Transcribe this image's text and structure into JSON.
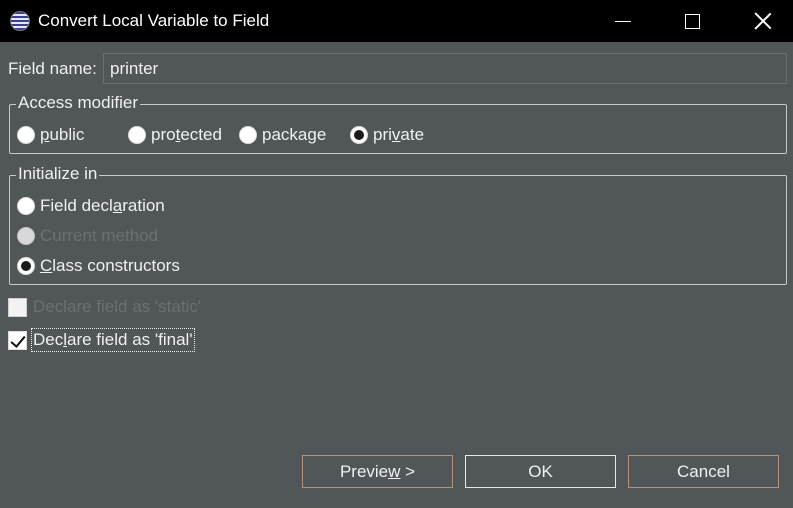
{
  "window": {
    "title": "Convert Local Variable to Field",
    "icon": "eclipse-icon"
  },
  "field_name": {
    "label": "Field name:",
    "value": "printer"
  },
  "access_modifier": {
    "title": "Access modifier",
    "options": [
      {
        "pre": "",
        "mn": "p",
        "post": "ublic",
        "checked": false
      },
      {
        "pre": "pro",
        "mn": "t",
        "post": "ected",
        "checked": false
      },
      {
        "pre": "packa",
        "mn": "g",
        "post": "e",
        "checked": false
      },
      {
        "pre": "pri",
        "mn": "v",
        "post": "ate",
        "checked": true
      }
    ]
  },
  "initialize_in": {
    "title": "Initialize in",
    "options": [
      {
        "pre": "Field decl",
        "mn": "a",
        "post": "ration",
        "checked": false,
        "enabled": true
      },
      {
        "pre": "Current method",
        "mn": "",
        "post": "",
        "checked": false,
        "enabled": false
      },
      {
        "pre": "",
        "mn": "C",
        "post": "lass constructors",
        "checked": true,
        "enabled": true
      }
    ]
  },
  "checkboxes": {
    "static": {
      "pre": "Declare field as 'static'",
      "mn": "",
      "post": "",
      "checked": false,
      "enabled": false
    },
    "final": {
      "pre": "Dec",
      "mn": "l",
      "post": "are field as 'final'",
      "checked": true,
      "enabled": true
    }
  },
  "buttons": {
    "preview": {
      "pre": "Previe",
      "mn": "w",
      "post": " >"
    },
    "ok": "OK",
    "cancel": "Cancel"
  }
}
